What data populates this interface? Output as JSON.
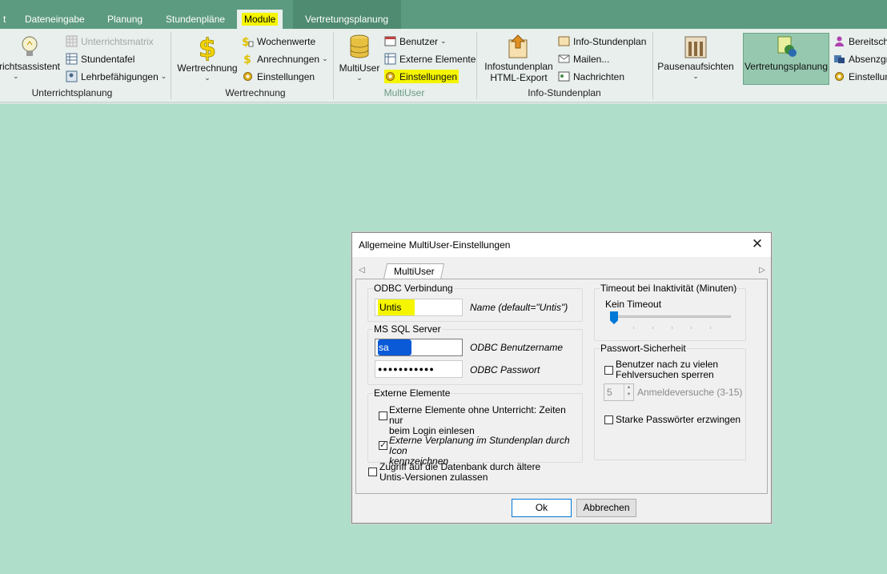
{
  "tabs": [
    "t",
    "Dateneingabe",
    "Planung",
    "Stundenpläne",
    "Module",
    "Vertretungsplanung"
  ],
  "ribbon": {
    "unterrichtsplanung": {
      "assistant_label": "richtsassistent",
      "unterrichtsmatrix": "Unterrichtsmatrix",
      "stundentafel": "Stundentafel",
      "lehrbefaehigungen": "Lehrbefähigungen",
      "group_label": "Unterrichtsplanung"
    },
    "wertrechnung": {
      "big_label": "Wertrechnung",
      "wochenwerte": "Wochenwerte",
      "anrechnungen": "Anrechnungen",
      "einstellungen": "Einstellungen",
      "group_label": "Wertrechnung"
    },
    "multiuser": {
      "big_label": "MultiUser",
      "benutzer": "Benutzer",
      "externe_elemente": "Externe Elemente",
      "einstellungen": "Einstellungen",
      "group_label": "MultiUser"
    },
    "infostundenplan": {
      "big_label_1": "Infostundenplan",
      "big_label_2": "HTML-Export",
      "info_stundenplan": "Info-Stundenplan",
      "mailen": "Mailen...",
      "nachrichten": "Nachrichten",
      "group_label": "Info-Stundenplan"
    },
    "pausen": {
      "big_label": "Pausenaufsichten"
    },
    "vertretung": {
      "big_label": "Vertretungsplanung",
      "bereitschaft": "Bereitscha",
      "absenzgr": "Absenzgr",
      "einstellun": "Einstellun"
    }
  },
  "dialog": {
    "title": "Allgemeine MultiUser-Einstellungen",
    "tab_label": "MultiUser",
    "odbc": {
      "group_title": "ODBC Verbindung",
      "name_value": "Untis",
      "name_hint": "Name (default=\"Untis\")"
    },
    "sql": {
      "group_title": "MS SQL Server",
      "user_value": "sa",
      "user_hint": "ODBC Benutzername",
      "password_value": "●●●●●●●●●●●",
      "password_hint": "ODBC Passwort"
    },
    "externe": {
      "group_title": "Externe Elemente",
      "opt1_line1": "Externe Elemente ohne Unterricht: Zeiten nur",
      "opt1_line2": "beim Login einlesen",
      "opt2_line1": "Externe Verplanung im Stundenplan durch Icon",
      "opt2_line2": "kennzeichnen"
    },
    "legacy_line1": "Zugriff auf die Datenbank durch ältere",
    "legacy_line2": "Untis-Versionen zulassen",
    "timeout": {
      "group_title": "Timeout bei Inaktivität (Minuten)",
      "value_label": "Kein Timeout",
      "level": 0
    },
    "passwort": {
      "group_title": "Passwort-Sicherheit",
      "lock_line1": "Benutzer nach zu vielen",
      "lock_line2": "Fehlversuchen sperren",
      "attempts_value": "5",
      "attempts_label": "Anmeldeversuche (3-15)",
      "strong": "Starke Passwörter erzwingen"
    },
    "ok_label": "Ok",
    "cancel_label": "Abbrechen"
  }
}
